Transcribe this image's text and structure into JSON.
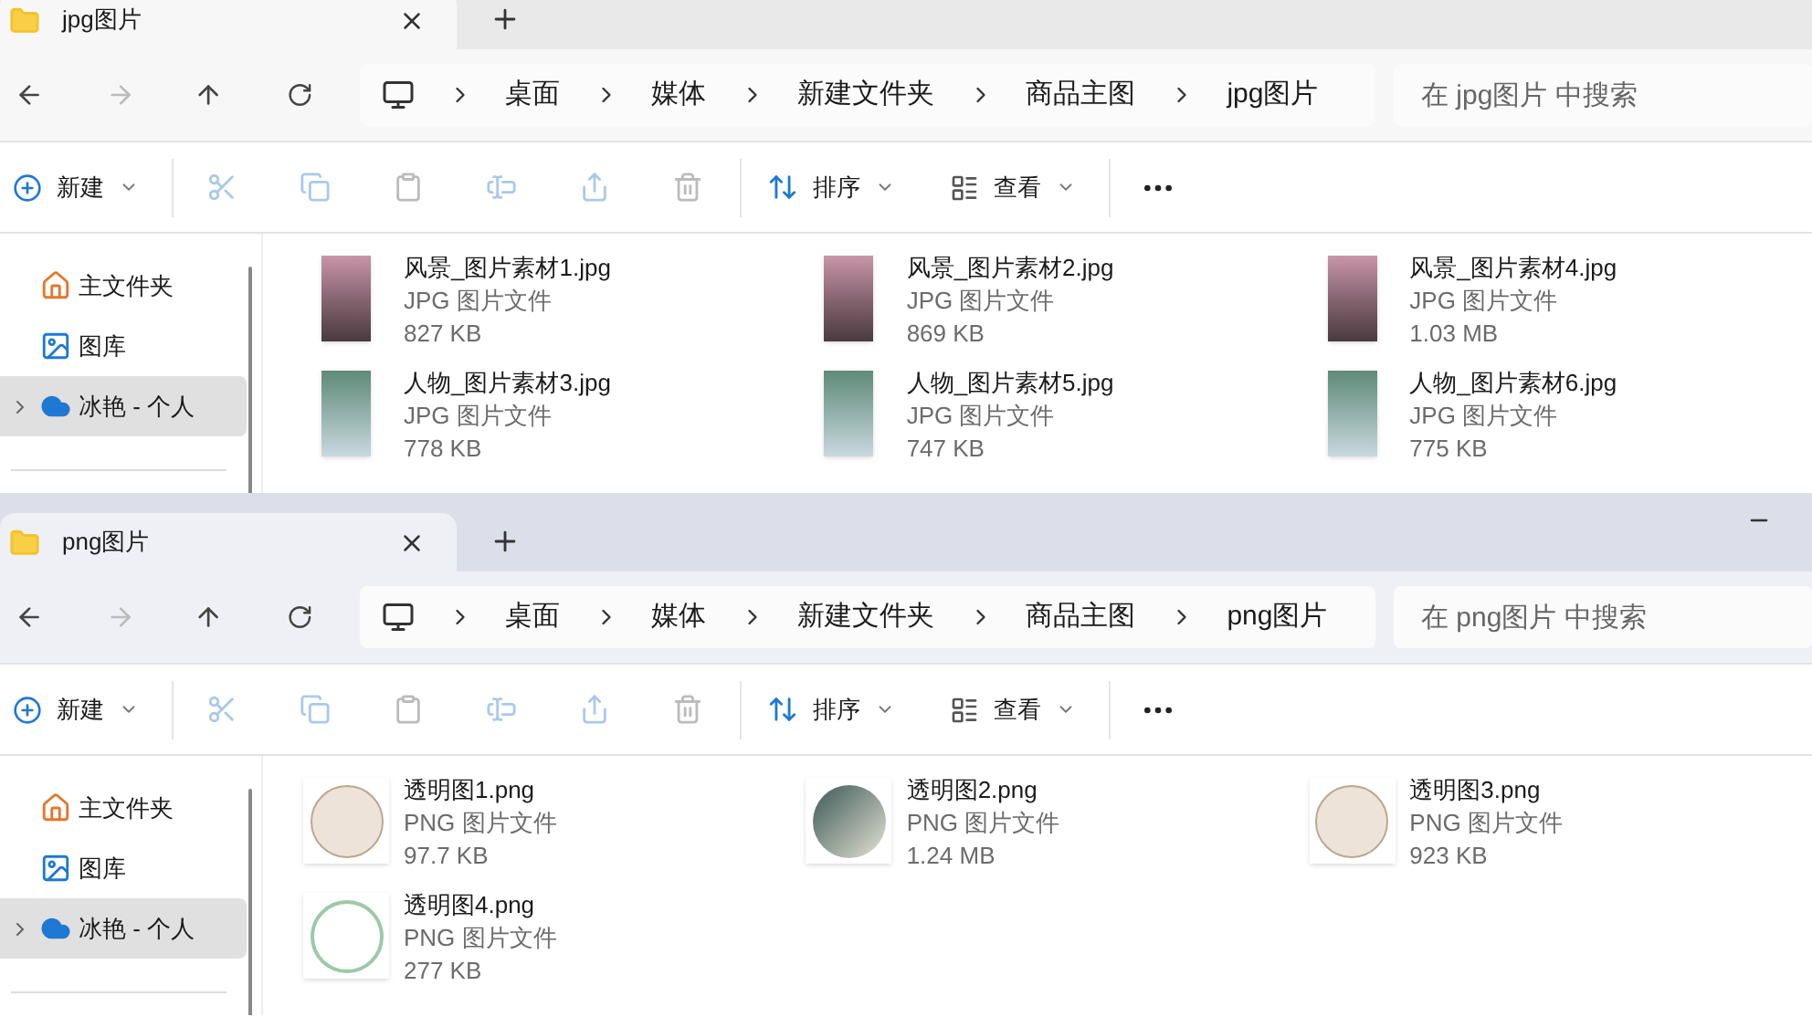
{
  "windows": [
    {
      "tab_title": "jpg图片",
      "active": false,
      "has_minimize": false,
      "breadcrumbs": [
        "桌面",
        "媒体",
        "新建文件夹",
        "商品主图",
        "jpg图片"
      ],
      "search_placeholder": "在 jpg图片 中搜索",
      "toolbar": {
        "new": "新建",
        "sort": "排序",
        "view": "查看"
      },
      "sidebar": [
        {
          "label": "主文件夹",
          "kind": "home",
          "selected": false,
          "expandable": false
        },
        {
          "label": "图库",
          "kind": "gallery",
          "selected": false,
          "expandable": false
        },
        {
          "label": "冰艳 - 个人",
          "kind": "cloud",
          "selected": true,
          "expandable": true
        }
      ],
      "files": [
        {
          "name": "风景_图片素材1.jpg",
          "type": "JPG 图片文件",
          "size": "827 KB",
          "kind": "landscape"
        },
        {
          "name": "风景_图片素材2.jpg",
          "type": "JPG 图片文件",
          "size": "869 KB",
          "kind": "landscape"
        },
        {
          "name": "风景_图片素材4.jpg",
          "type": "JPG 图片文件",
          "size": "1.03 MB",
          "kind": "landscape"
        },
        {
          "name": "人物_图片素材3.jpg",
          "type": "JPG 图片文件",
          "size": "778 KB",
          "kind": "figure"
        },
        {
          "name": "人物_图片素材5.jpg",
          "type": "JPG 图片文件",
          "size": "747 KB",
          "kind": "figure"
        },
        {
          "name": "人物_图片素材6.jpg",
          "type": "JPG 图片文件",
          "size": "775 KB",
          "kind": "figure"
        }
      ]
    },
    {
      "tab_title": "png图片",
      "active": true,
      "has_minimize": true,
      "breadcrumbs": [
        "桌面",
        "媒体",
        "新建文件夹",
        "商品主图",
        "png图片"
      ],
      "search_placeholder": "在 png图片 中搜索",
      "toolbar": {
        "new": "新建",
        "sort": "排序",
        "view": "查看"
      },
      "sidebar": [
        {
          "label": "主文件夹",
          "kind": "home",
          "selected": false,
          "expandable": false
        },
        {
          "label": "图库",
          "kind": "gallery",
          "selected": false,
          "expandable": false
        },
        {
          "label": "冰艳 - 个人",
          "kind": "cloud",
          "selected": true,
          "expandable": true
        }
      ],
      "files": [
        {
          "name": "透明图1.png",
          "type": "PNG 图片文件",
          "size": "97.7 KB",
          "kind": "frame"
        },
        {
          "name": "透明图2.png",
          "type": "PNG 图片文件",
          "size": "1.24 MB",
          "kind": "disc"
        },
        {
          "name": "透明图3.png",
          "type": "PNG 图片文件",
          "size": "923 KB",
          "kind": "frame"
        },
        {
          "name": "透明图4.png",
          "type": "PNG 图片文件",
          "size": "277 KB",
          "kind": "wreath"
        }
      ]
    }
  ]
}
